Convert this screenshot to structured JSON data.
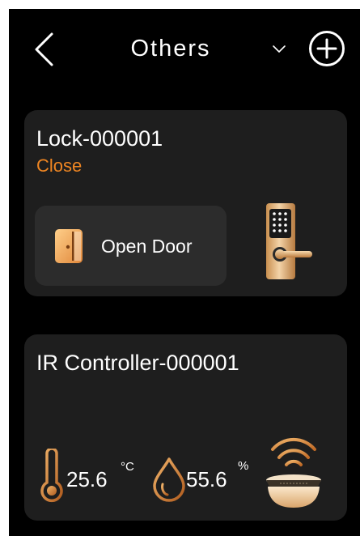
{
  "header": {
    "title": "Others",
    "back_icon": "chevron-left-icon",
    "dropdown_icon": "chevron-down-icon",
    "add_icon": "plus-circle-icon"
  },
  "lock_card": {
    "name": "Lock-000001",
    "status": "Close",
    "action_label": "Open Door",
    "action_icon": "door-icon"
  },
  "ir_card": {
    "name": "IR Controller-000001",
    "temperature": "25.6",
    "temperature_unit": "°C",
    "humidity": "55.6",
    "humidity_unit": "%"
  },
  "colors": {
    "background": "#000000",
    "card": "#1e1e1e",
    "button": "#2c2c2c",
    "accent": "#ee8522",
    "text": "#ffffff"
  }
}
